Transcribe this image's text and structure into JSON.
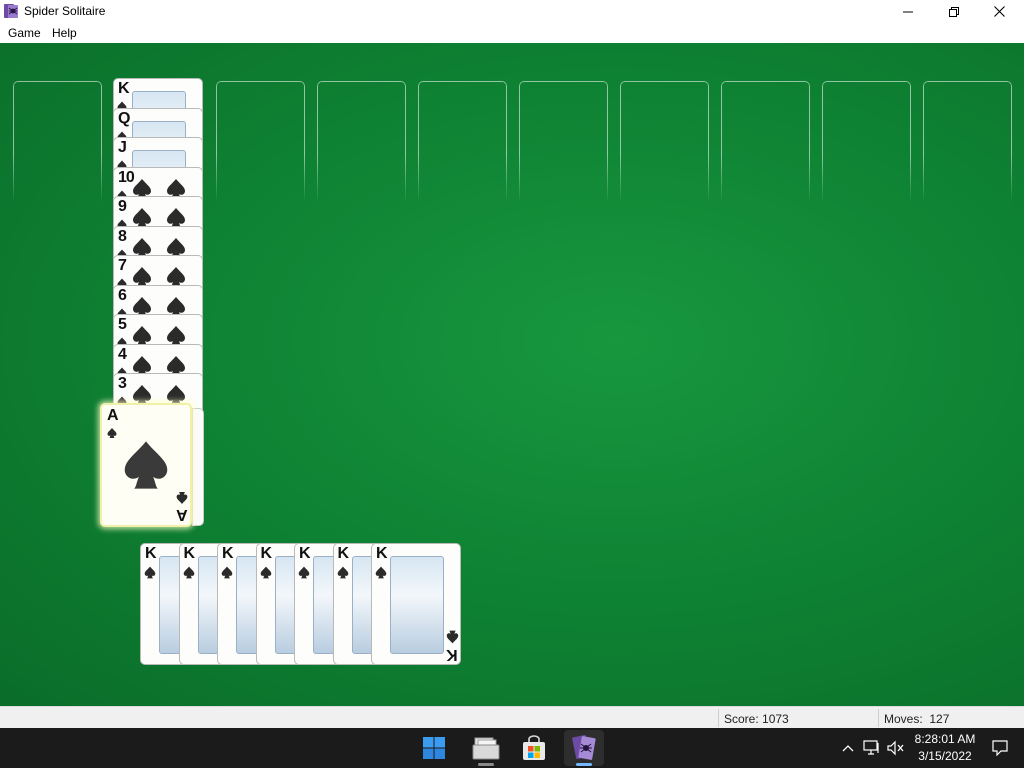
{
  "window": {
    "title": "Spider Solitaire"
  },
  "menu": {
    "items": [
      "Game",
      "Help"
    ]
  },
  "tableau": {
    "column2_ranks": [
      "K",
      "Q",
      "J",
      "10",
      "9",
      "8",
      "7",
      "6",
      "5",
      "4",
      "3"
    ],
    "selected_card": {
      "rank": "A",
      "suit": "spade"
    },
    "completed_sets": [
      "K",
      "K",
      "K",
      "K",
      "K",
      "K",
      "K"
    ]
  },
  "status": {
    "score_label": "Score: 1073",
    "moves_label": "Moves:  127"
  },
  "taskbar": {
    "time": "8:28:01 AM",
    "date": "3/15/2022"
  },
  "icons": {
    "app": "spider-solitaire-icon",
    "minimize": "minimize-icon",
    "restore": "restore-icon",
    "close": "close-icon",
    "start": "windows-start-icon",
    "explorer": "file-explorer-icon",
    "store": "store-icon",
    "solitaire": "spider-solitaire-taskbar-icon",
    "chevron": "chevron-up-icon",
    "network": "network-icon",
    "volume": "volume-muted-icon",
    "notifications": "notification-icon"
  },
  "colors": {
    "felt": "#0f8434",
    "highlight": "#f0f0a8",
    "taskbar": "#1b1b1b"
  }
}
